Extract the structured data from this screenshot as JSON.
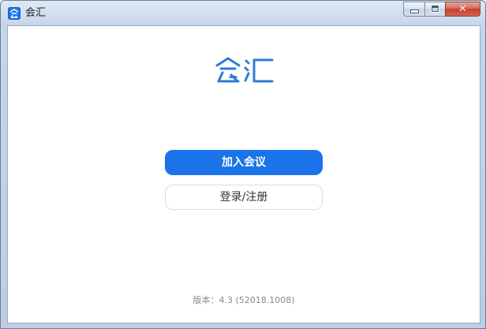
{
  "window": {
    "title": "会汇",
    "controls": {
      "close_symbol": "✕"
    }
  },
  "logo": {
    "text": "会汇",
    "color": "#2f7bd9"
  },
  "buttons": {
    "join_label": "加入会议",
    "login_label": "登录/注册"
  },
  "footer": {
    "version_text": "版本：4.3 (52018.1008)"
  },
  "colors": {
    "primary": "#1a73e8",
    "close_button": "#c4402d"
  }
}
